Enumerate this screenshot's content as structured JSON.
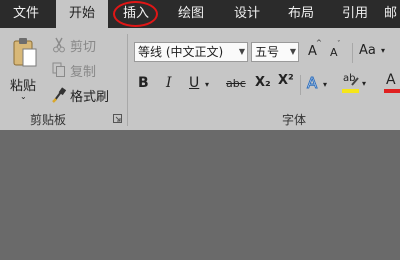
{
  "tabs": [
    "文件",
    "开始",
    "插入",
    "绘图",
    "设计",
    "布局",
    "引用",
    "邮"
  ],
  "clipboard": {
    "paste_label": "粘贴",
    "cut_label": "剪切",
    "copy_label": "复制",
    "format_painter_label": "格式刷",
    "group_label": "剪贴板"
  },
  "font": {
    "font_name": "等线 (中文正文)",
    "font_size": "五号",
    "grow_label": "A",
    "shrink_label": "A",
    "case_label": "Aa",
    "bold_label": "B",
    "italic_label": "I",
    "underline_label": "U",
    "strike_label": "abc",
    "sub_label": "X₂",
    "sup_label": "X²",
    "effects_label": "A",
    "highlight_label": "ab",
    "color_label": "A",
    "group_label": "字体"
  },
  "colors": {
    "tabbar": "#2b2b2b",
    "ribbon": "#c6c6c6",
    "document": "#6a6a6a",
    "annotation": "#e01616",
    "highlight": "#f5e61a",
    "font_color": "#e02020"
  }
}
